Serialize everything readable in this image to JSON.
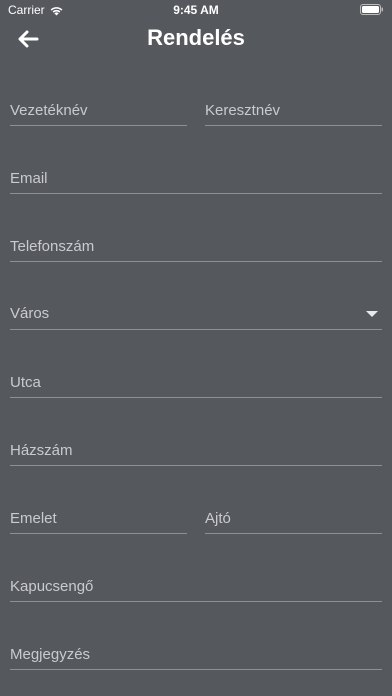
{
  "status_bar": {
    "carrier": "Carrier",
    "time": "9:45 AM",
    "icons": [
      "wifi-icon",
      "battery-icon"
    ]
  },
  "header": {
    "title": "Rendelés",
    "back_icon": "arrow-left-icon"
  },
  "form": {
    "last_name": {
      "placeholder": "Vezetéknév",
      "value": ""
    },
    "first_name": {
      "placeholder": "Keresztnév",
      "value": ""
    },
    "email": {
      "placeholder": "Email",
      "value": ""
    },
    "phone": {
      "placeholder": "Telefonszám",
      "value": ""
    },
    "city": {
      "label": "Város",
      "value": "",
      "icon": "caret-down-icon"
    },
    "street": {
      "placeholder": "Utca",
      "value": ""
    },
    "house_number": {
      "placeholder": "Házszám",
      "value": ""
    },
    "floor": {
      "placeholder": "Emelet",
      "value": ""
    },
    "door": {
      "placeholder": "Ajtó",
      "value": ""
    },
    "doorbell": {
      "placeholder": "Kapucsengő",
      "value": ""
    },
    "note": {
      "placeholder": "Megjegyzés",
      "value": ""
    }
  },
  "colors": {
    "background": "#55585d",
    "text": "#ffffff",
    "placeholder": "#c9cbce",
    "underline": "#8d9095"
  }
}
